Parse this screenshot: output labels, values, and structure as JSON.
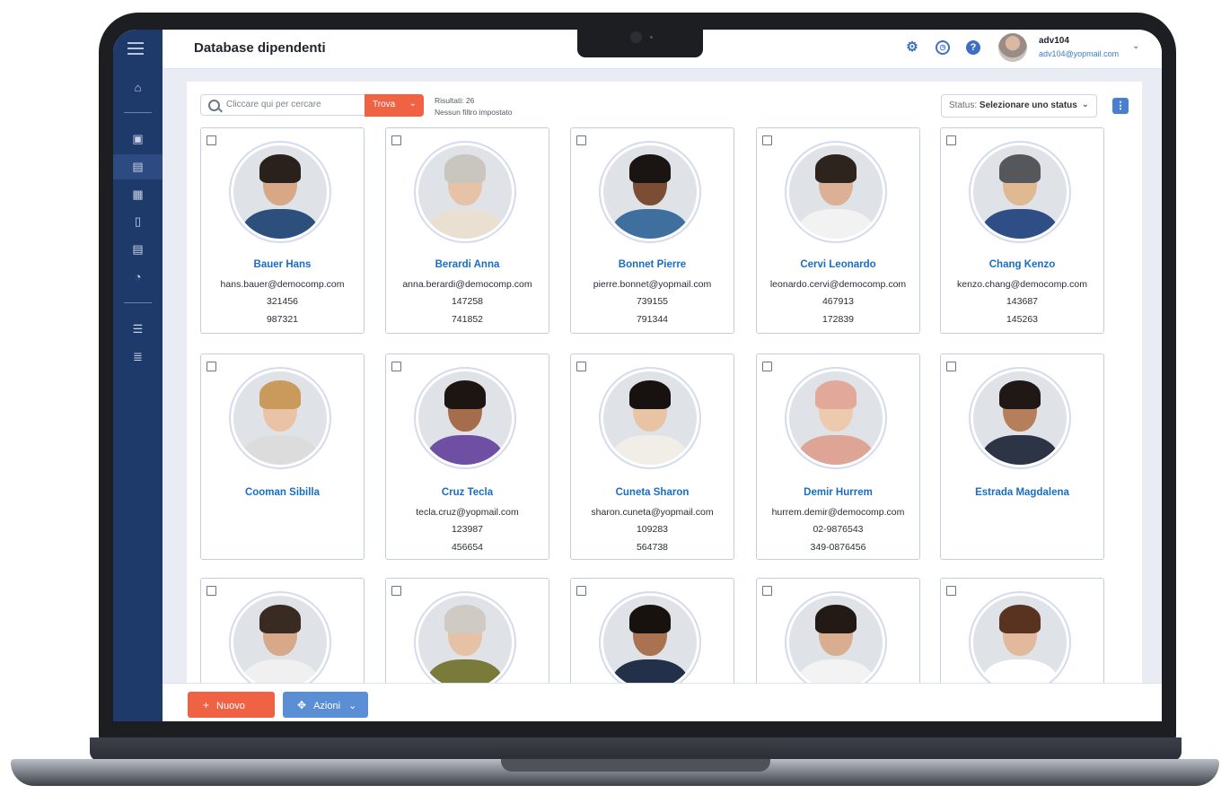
{
  "app": {
    "page_title": "Database dipendenti",
    "user": {
      "name": "adv104",
      "email": "adv104@yopmail.com"
    },
    "colors": {
      "sidebar": "#1e3a6b",
      "accent_orange": "#ef6244",
      "accent_blue": "#5a8fd6",
      "name_link": "#1b6dc1"
    }
  },
  "toolbar": {
    "search_placeholder": "Cliccare qui per cercare",
    "find_label": "Trova",
    "results_label": "Risultati: 26",
    "filter_label": "Nessun filtro impostato",
    "status_label": "Status:",
    "status_value": "Selezionare uno status"
  },
  "footer": {
    "new_label": "Nuovo",
    "actions_label": "Azioni"
  },
  "employees": [
    {
      "name": "Bauer Hans",
      "email": "hans.bauer@democomp.com",
      "phone1": "321456",
      "phone2": "987321",
      "skin": "#d8a886",
      "hair": "#2a211c",
      "shirt": "#2c4f7c"
    },
    {
      "name": "Berardi Anna",
      "email": "anna.berardi@democomp.com",
      "phone1": "147258",
      "phone2": "741852",
      "skin": "#e6c2a7",
      "hair": "#c9c5bf",
      "shirt": "#e9e0d2"
    },
    {
      "name": "Bonnet Pierre",
      "email": "pierre.bonnet@yopmail.com",
      "phone1": "739155",
      "phone2": "791344",
      "skin": "#7a4d34",
      "hair": "#1a1412",
      "shirt": "#3f6f9e"
    },
    {
      "name": "Cervi Leonardo",
      "email": "leonardo.cervi@democomp.com",
      "phone1": "467913",
      "phone2": "172839",
      "skin": "#dcb095",
      "hair": "#2e241e",
      "shirt": "#f2f2f2"
    },
    {
      "name": "Chang Kenzo",
      "email": "kenzo.chang@democomp.com",
      "phone1": "143687",
      "phone2": "145263",
      "skin": "#e0b892",
      "hair": "#55575a",
      "shirt": "#2f4e85"
    },
    {
      "name": "Cooman Sibilla",
      "email": "",
      "phone1": "",
      "phone2": "",
      "skin": "#eac3a6",
      "hair": "#c99a5b",
      "shirt": "#dcdcdc"
    },
    {
      "name": "Cruz Tecla",
      "email": "tecla.cruz@yopmail.com",
      "phone1": "123987",
      "phone2": "456654",
      "skin": "#a56d4b",
      "hair": "#1d1512",
      "shirt": "#6e4fa3"
    },
    {
      "name": "Cuneta Sharon",
      "email": "sharon.cuneta@yopmail.com",
      "phone1": "109283",
      "phone2": "564738",
      "skin": "#e8c4a4",
      "hair": "#17120f",
      "shirt": "#f1eee8"
    },
    {
      "name": "Demir Hurrem",
      "email": "hurrem.demir@democomp.com",
      "phone1": "02-9876543",
      "phone2": "349-0876456",
      "skin": "#edc9ad",
      "hair": "#e2a99a",
      "shirt": "#dea495"
    },
    {
      "name": "Estrada Magdalena",
      "email": "",
      "phone1": "",
      "phone2": "",
      "skin": "#b67f5c",
      "hair": "#1f1814",
      "shirt": "#2c3445"
    },
    {
      "name": "",
      "email": "",
      "phone1": "",
      "phone2": "",
      "skin": "#d6a98a",
      "hair": "#3a2b22",
      "shirt": "#f0f0f0"
    },
    {
      "name": "",
      "email": "",
      "phone1": "",
      "phone2": "",
      "skin": "#e5c2a6",
      "hair": "#cfcac4",
      "shirt": "#7a7a3a"
    },
    {
      "name": "",
      "email": "",
      "phone1": "",
      "phone2": "",
      "skin": "#a97352",
      "hair": "#18120f",
      "shirt": "#22304a"
    },
    {
      "name": "",
      "email": "",
      "phone1": "",
      "phone2": "",
      "skin": "#d9ad90",
      "hair": "#241a15",
      "shirt": "#f3f3f3"
    },
    {
      "name": "",
      "email": "",
      "phone1": "",
      "phone2": "",
      "skin": "#e3b99c",
      "hair": "#5a3220",
      "shirt": "#ffffff"
    }
  ]
}
